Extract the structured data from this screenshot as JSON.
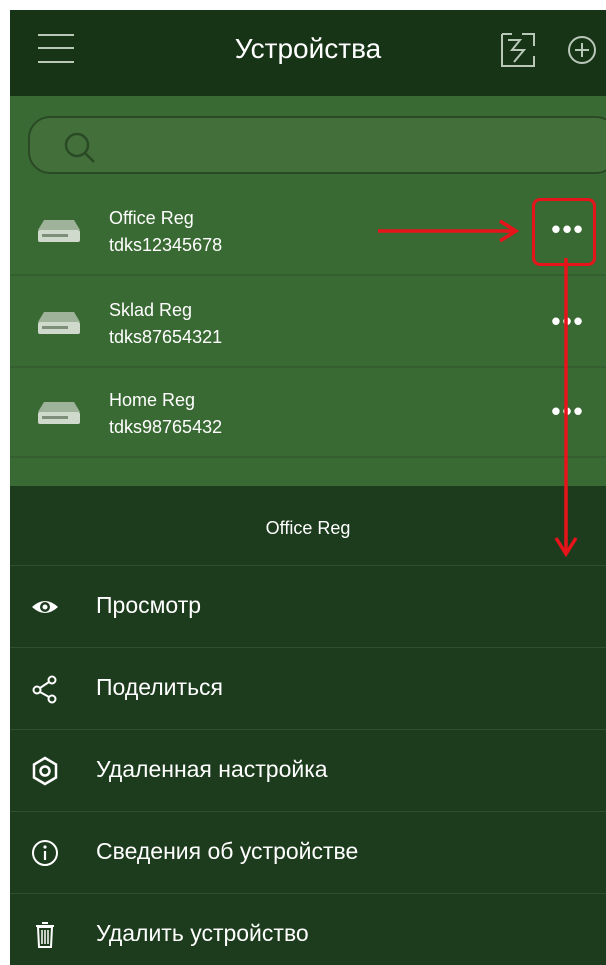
{
  "header": {
    "title": "Устройства",
    "menu_icon": "hamburger-icon",
    "import_icon": "qr-import-icon",
    "add_icon": "plus-circle-icon"
  },
  "search": {
    "placeholder": "",
    "icon": "search-icon"
  },
  "devices": [
    {
      "name": "Office Reg",
      "serial": "tdks12345678",
      "icon": "recorder-icon",
      "more": "•••"
    },
    {
      "name": "Sklad Reg",
      "serial": "tdks87654321",
      "icon": "recorder-icon",
      "more": "•••"
    },
    {
      "name": "Home Reg",
      "serial": "tdks98765432",
      "icon": "recorder-icon",
      "more": "•••"
    }
  ],
  "action_sheet": {
    "title": "Office Reg",
    "items": [
      {
        "label": "Просмотр",
        "icon": "eye-icon"
      },
      {
        "label": "Поделиться",
        "icon": "share-icon"
      },
      {
        "label": "Удаленная настройка",
        "icon": "gear-icon"
      },
      {
        "label": "Сведения об устройстве",
        "icon": "info-icon"
      },
      {
        "label": "Удалить устройство",
        "icon": "trash-icon"
      }
    ]
  },
  "colors": {
    "header_bg": "#173417",
    "list_bg": "#3a6a34",
    "sheet_bg": "#1d3b1d",
    "annotation": "#e5141a",
    "text": "#ffffff"
  }
}
